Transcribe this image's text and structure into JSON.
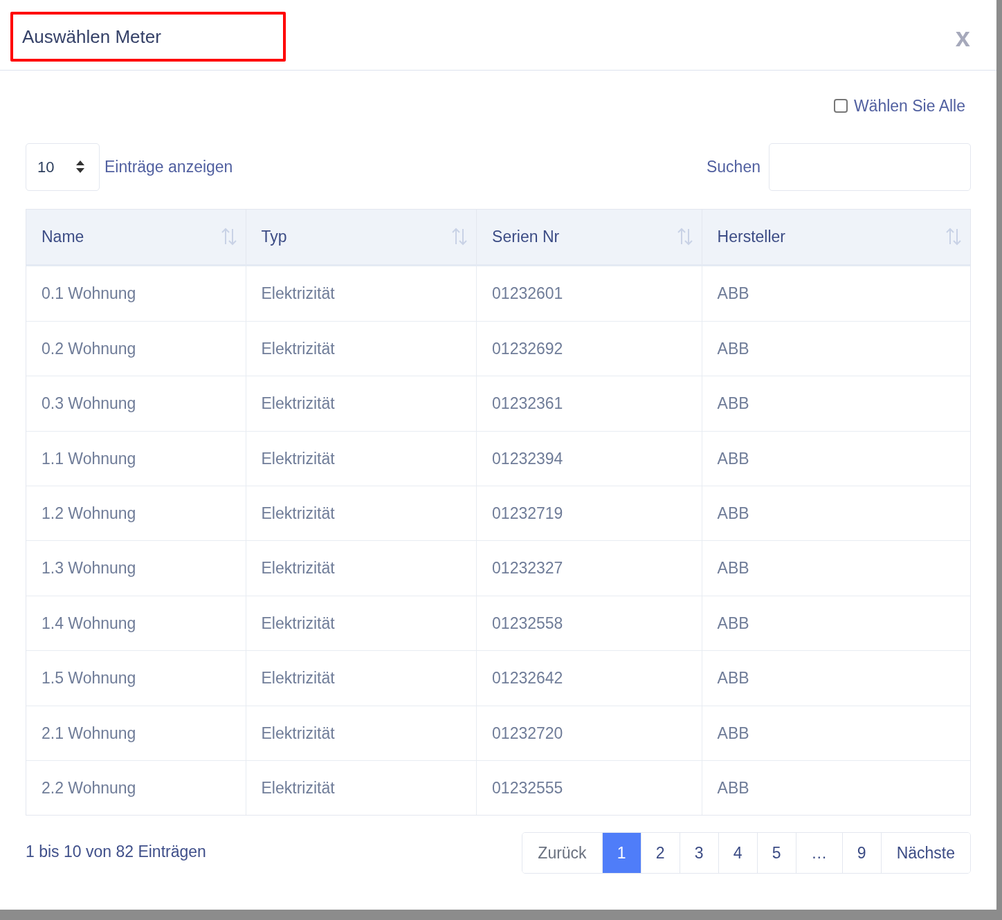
{
  "dialog": {
    "title": "Auswählen Meter",
    "title_highlighted": true,
    "close": "x"
  },
  "select_all": {
    "label": "Wählen Sie Alle",
    "checked": false
  },
  "length": {
    "value": "10",
    "label": "Einträge anzeigen"
  },
  "search": {
    "label": "Suchen"
  },
  "table": {
    "columns": [
      "Name",
      "Typ",
      "Serien Nr",
      "Hersteller"
    ],
    "rows": [
      [
        "0.1 Wohnung",
        "Elektrizität",
        "01232601",
        "ABB"
      ],
      [
        "0.2 Wohnung",
        "Elektrizität",
        "01232692",
        "ABB"
      ],
      [
        "0.3 Wohnung",
        "Elektrizität",
        "01232361",
        "ABB"
      ],
      [
        "1.1 Wohnung",
        "Elektrizität",
        "01232394",
        "ABB"
      ],
      [
        "1.2 Wohnung",
        "Elektrizität",
        "01232719",
        "ABB"
      ],
      [
        "1.3 Wohnung",
        "Elektrizität",
        "01232327",
        "ABB"
      ],
      [
        "1.4 Wohnung",
        "Elektrizität",
        "01232558",
        "ABB"
      ],
      [
        "1.5 Wohnung",
        "Elektrizität",
        "01232642",
        "ABB"
      ],
      [
        "2.1 Wohnung",
        "Elektrizität",
        "01232720",
        "ABB"
      ],
      [
        "2.2 Wohnung",
        "Elektrizität",
        "01232555",
        "ABB"
      ]
    ]
  },
  "info": "1 bis 10 von 82 Einträgen",
  "pagination": [
    {
      "label": "Zurück",
      "kind": "nav",
      "selected": false
    },
    {
      "label": "1",
      "kind": "page",
      "selected": true
    },
    {
      "label": "2",
      "kind": "page",
      "selected": false
    },
    {
      "label": "3",
      "kind": "page",
      "selected": false
    },
    {
      "label": "4",
      "kind": "page",
      "selected": false
    },
    {
      "label": "5",
      "kind": "page",
      "selected": false
    },
    {
      "label": "…",
      "kind": "gap",
      "selected": false
    },
    {
      "label": "9",
      "kind": "page",
      "selected": false
    },
    {
      "label": "Nächste",
      "kind": "nav",
      "selected": false
    }
  ]
}
